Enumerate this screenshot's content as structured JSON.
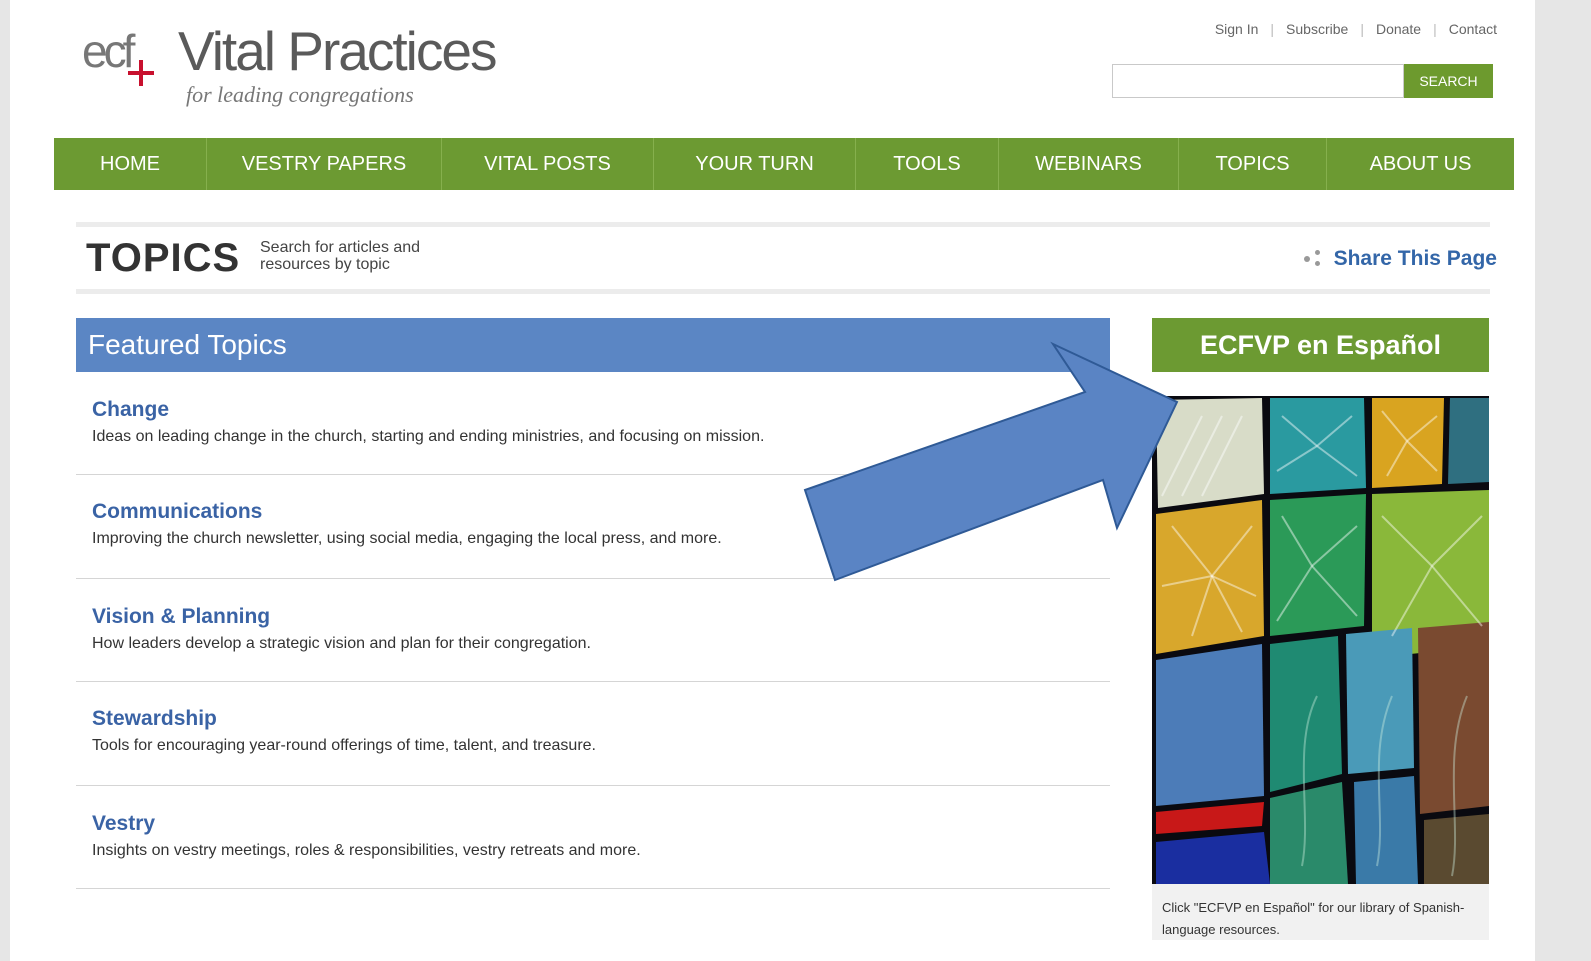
{
  "header": {
    "logo_mark": "ecf",
    "logo_title": "Vital Practices",
    "logo_tagline": "for leading congregations",
    "top_links": [
      "Sign In",
      "Subscribe",
      "Donate",
      "Contact"
    ],
    "search_placeholder": "",
    "search_button": "SEARCH"
  },
  "nav": {
    "items": [
      "HOME",
      "VESTRY PAPERS",
      "VITAL POSTS",
      "YOUR TURN",
      "TOOLS",
      "WEBINARS",
      "TOPICS",
      "ABOUT US"
    ]
  },
  "page_header": {
    "title": "TOPICS",
    "subtitle": "Search for articles and resources by topic",
    "share_label": "Share This Page",
    "share_icon": "share-icon"
  },
  "featured": {
    "heading": "Featured Topics",
    "topics": [
      {
        "title": "Change",
        "description": "Ideas on leading change in the church, starting and ending ministries, and focusing on mission."
      },
      {
        "title": "Communications",
        "description": "Improving the church newsletter, using social media, engaging the local press, and more."
      },
      {
        "title": "Vision & Planning",
        "description": "How leaders develop a strategic vision and plan for their congregation."
      },
      {
        "title": "Stewardship",
        "description": "Tools for encouraging year-round offerings of time, talent, and treasure."
      },
      {
        "title": "Vestry",
        "description": "Insights on vestry meetings, roles & responsibilities, vestry retreats and more."
      }
    ]
  },
  "sidebar": {
    "button_label": "ECFVP en Español",
    "caption": "Click \"ECFVP en Español\" for our library of Spanish-language resources."
  },
  "colors": {
    "nav_green": "#6c9a32",
    "featured_blue": "#5b86c4",
    "link_blue": "#3a63a5",
    "arrow_blue": "#5a84c4",
    "logo_red": "#c8102e"
  }
}
